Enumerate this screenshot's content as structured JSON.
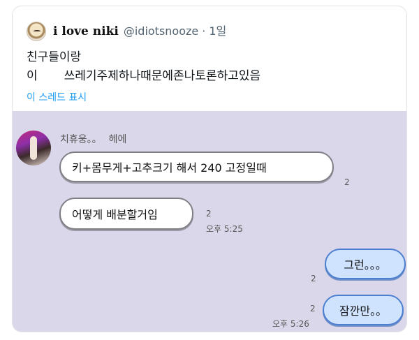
{
  "tweet": {
    "display_name": "i love niki",
    "handle": "@idiotsnooze",
    "separator": "·",
    "time": "1일",
    "text_line1": "친구들이랑",
    "text_line2_a": "이",
    "text_line2_b": "쓰레기주제하나때문에존나토론하고있음",
    "thread_link": "이 스레드 표시"
  },
  "chat": {
    "sender_name": "치휴웅。。",
    "sender_greeting": "헤에",
    "messages": [
      {
        "side": "in",
        "text": "키+몸무게+고추크기 해서 240 고정일때",
        "read": "2",
        "time": ""
      },
      {
        "side": "in",
        "text": "어떻게 배분할거임",
        "read": "2",
        "time": "오후 5:25"
      },
      {
        "side": "out",
        "text": "그런。。。",
        "read": "2",
        "time": ""
      },
      {
        "side": "out",
        "text": "잠깐만。。",
        "read": "2",
        "time": "오후 5:26"
      }
    ]
  },
  "colors": {
    "chat_background": "#dad7ea",
    "incoming_bubble": "#ffffff",
    "outgoing_bubble": "#cfe3ff",
    "link": "#1d9bf0"
  },
  "icons": {
    "profile_avatar": "cartoon-avatar-icon",
    "chat_avatar": "contact-photo-icon"
  }
}
